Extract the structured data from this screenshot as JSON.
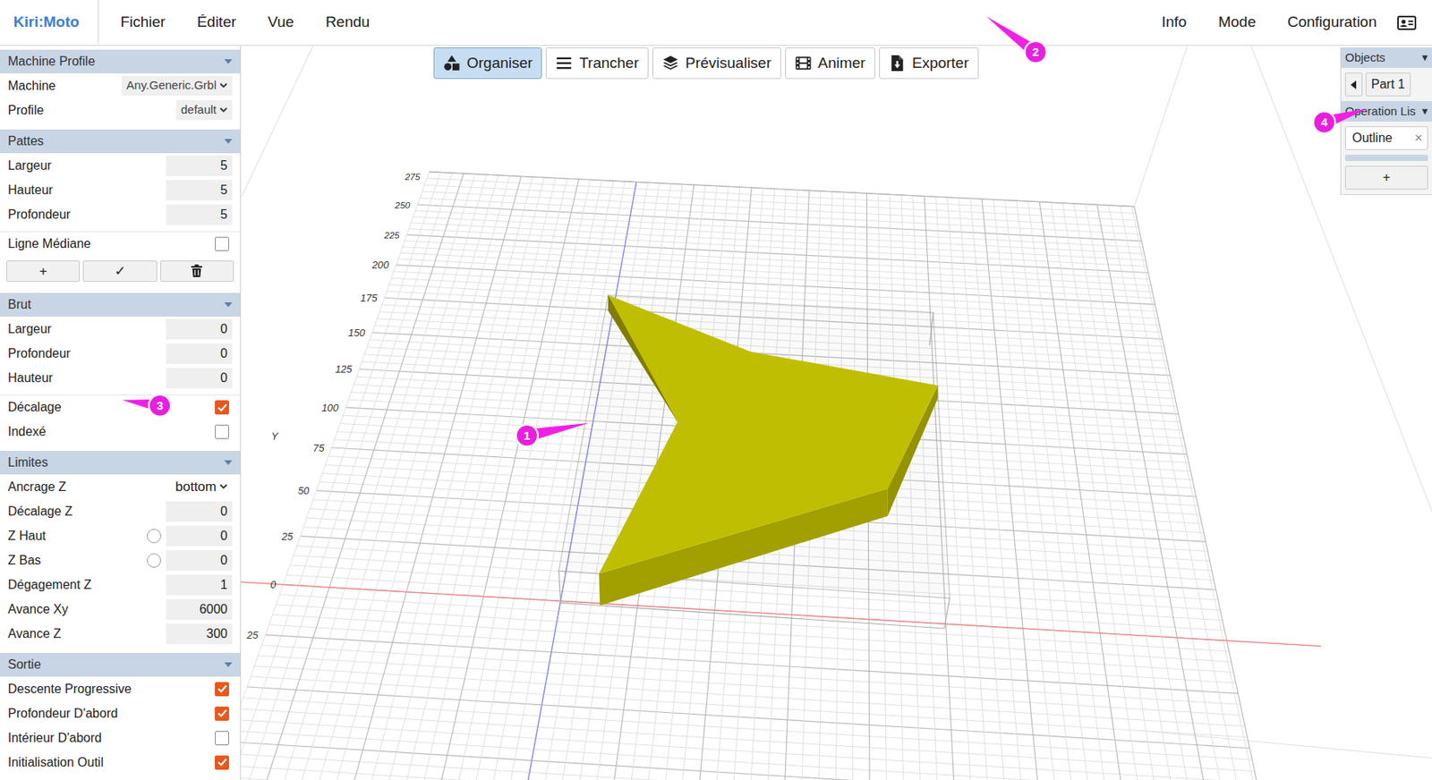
{
  "app": {
    "logo": "Kiri:Moto"
  },
  "menu_left": [
    "Fichier",
    "Éditer",
    "Vue",
    "Rendu"
  ],
  "menu_right": [
    "Info",
    "Mode",
    "Configuration"
  ],
  "toolbar": [
    {
      "label": "Organiser",
      "selected": true
    },
    {
      "label": "Trancher",
      "selected": false
    },
    {
      "label": "Prévisualiser",
      "selected": false
    },
    {
      "label": "Animer",
      "selected": false
    },
    {
      "label": "Exporter",
      "selected": false
    }
  ],
  "sidebar": {
    "sections": [
      {
        "title": "Machine Profile",
        "rows": [
          {
            "kind": "select",
            "label": "Machine",
            "value": "Any.Generic.Grbl"
          },
          {
            "kind": "select",
            "label": "Profile",
            "value": "default"
          }
        ]
      },
      {
        "title": "Pattes",
        "rows": [
          {
            "kind": "number",
            "label": "Largeur",
            "value": "5"
          },
          {
            "kind": "number",
            "label": "Hauteur",
            "value": "5"
          },
          {
            "kind": "number",
            "label": "Profondeur",
            "value": "5"
          },
          {
            "kind": "checkbox",
            "label": "Ligne Médiane",
            "checked": false
          },
          {
            "kind": "buttons",
            "buttons": [
              "+",
              "✓"
            ]
          }
        ]
      },
      {
        "title": "Brut",
        "rows": [
          {
            "kind": "number",
            "label": "Largeur",
            "value": "0"
          },
          {
            "kind": "number",
            "label": "Profondeur",
            "value": "0"
          },
          {
            "kind": "number",
            "label": "Hauteur",
            "value": "0"
          },
          {
            "kind": "checkbox",
            "label": "Décalage",
            "checked": true
          },
          {
            "kind": "checkbox",
            "label": "Indexé",
            "checked": false
          }
        ]
      },
      {
        "title": "Limites",
        "rows": [
          {
            "kind": "select",
            "label": "Ancrage Z",
            "value": "bottom"
          },
          {
            "kind": "number",
            "label": "Décalage Z",
            "value": "0"
          },
          {
            "kind": "radio-number",
            "label": "Z Haut",
            "value": "0",
            "checked": false
          },
          {
            "kind": "radio-number",
            "label": "Z Bas",
            "value": "0",
            "checked": false
          },
          {
            "kind": "number",
            "label": "Dégagement Z",
            "value": "1"
          },
          {
            "kind": "number",
            "label": "Avance Xy",
            "value": "6000"
          },
          {
            "kind": "number",
            "label": "Avance Z",
            "value": "300"
          }
        ]
      },
      {
        "title": "Sortie",
        "rows": [
          {
            "kind": "checkbox",
            "label": "Descente Progressive",
            "checked": true
          },
          {
            "kind": "checkbox",
            "label": "Profondeur D'abord",
            "checked": true
          },
          {
            "kind": "checkbox",
            "label": "Intérieur D'abord",
            "checked": false
          },
          {
            "kind": "checkbox",
            "label": "Initialisation Outil",
            "checked": true
          }
        ]
      }
    ]
  },
  "canvas": {
    "axis_labels": [
      "275",
      "250",
      "225",
      "200",
      "175",
      "150",
      "125",
      "100",
      "75",
      "50",
      "25",
      "0",
      "25"
    ],
    "axis_name": "Y"
  },
  "objects_panel": {
    "title": "Objects",
    "arrow": "▼",
    "part": "Part 1",
    "operations_title": "Operation Lis",
    "operations_arrow": "▼",
    "operations": [
      {
        "label": "Outline",
        "remove": "×"
      }
    ],
    "add": "+"
  },
  "callouts": [
    "1",
    "2",
    "3",
    "4"
  ]
}
